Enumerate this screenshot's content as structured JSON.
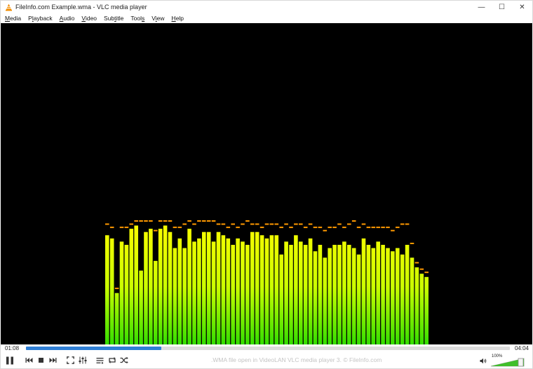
{
  "window": {
    "title": "FileInfo.com Example.wma - VLC media player",
    "controls": {
      "minimize": "—",
      "maximize": "☐",
      "close": "✕"
    }
  },
  "menu": [
    {
      "label": "Media",
      "accel": "M"
    },
    {
      "label": "Playback",
      "accel": "l"
    },
    {
      "label": "Audio",
      "accel": "A"
    },
    {
      "label": "Video",
      "accel": "V"
    },
    {
      "label": "Subtitle",
      "accel": "t"
    },
    {
      "label": "Tools",
      "accel": "s"
    },
    {
      "label": "View",
      "accel": "i"
    },
    {
      "label": "Help",
      "accel": "H"
    }
  ],
  "visualizer": {
    "type": "spectrum",
    "levels": [
      0.34,
      0.33,
      0.16,
      0.32,
      0.31,
      0.36,
      0.37,
      0.23,
      0.35,
      0.36,
      0.26,
      0.36,
      0.37,
      0.35,
      0.3,
      0.33,
      0.3,
      0.36,
      0.32,
      0.33,
      0.35,
      0.35,
      0.32,
      0.35,
      0.34,
      0.33,
      0.31,
      0.33,
      0.32,
      0.31,
      0.35,
      0.35,
      0.34,
      0.33,
      0.34,
      0.34,
      0.28,
      0.32,
      0.31,
      0.34,
      0.32,
      0.31,
      0.33,
      0.29,
      0.31,
      0.27,
      0.3,
      0.31,
      0.31,
      0.32,
      0.31,
      0.3,
      0.28,
      0.33,
      0.31,
      0.3,
      0.32,
      0.31,
      0.3,
      0.29,
      0.3,
      0.28,
      0.31,
      0.27,
      0.24,
      0.22,
      0.21
    ],
    "peaks": [
      0.37,
      0.36,
      0.17,
      0.36,
      0.36,
      0.37,
      0.38,
      0.38,
      0.38,
      0.38,
      0.35,
      0.38,
      0.38,
      0.38,
      0.36,
      0.36,
      0.37,
      0.38,
      0.37,
      0.38,
      0.38,
      0.38,
      0.38,
      0.37,
      0.37,
      0.36,
      0.37,
      0.36,
      0.37,
      0.38,
      0.37,
      0.37,
      0.36,
      0.37,
      0.37,
      0.37,
      0.36,
      0.37,
      0.36,
      0.37,
      0.37,
      0.36,
      0.37,
      0.36,
      0.36,
      0.35,
      0.36,
      0.36,
      0.37,
      0.36,
      0.37,
      0.38,
      0.36,
      0.37,
      0.36,
      0.36,
      0.36,
      0.36,
      0.36,
      0.35,
      0.36,
      0.37,
      0.37,
      0.31,
      0.25,
      0.23,
      0.22
    ],
    "colors": {
      "top": "#ffff00",
      "mid": "#ccff00",
      "bottom": "#33dd00",
      "peak": "#ff9900",
      "background": "#000000"
    }
  },
  "playback": {
    "elapsed": "01:08",
    "total": "04:04",
    "progress": 0.279
  },
  "status_text": ".WMA file open in VideoLAN VLC media player 3. © FileInfo.com",
  "volume": {
    "label": "100%",
    "level": 1.0
  },
  "accent_color": "#2f7fd6",
  "icons": [
    "vlc-cone-icon",
    "pause-icon",
    "previous-icon",
    "stop-icon",
    "next-icon",
    "fullscreen-icon",
    "extended-settings-icon",
    "playlist-icon",
    "loop-icon",
    "shuffle-icon",
    "speaker-icon"
  ]
}
